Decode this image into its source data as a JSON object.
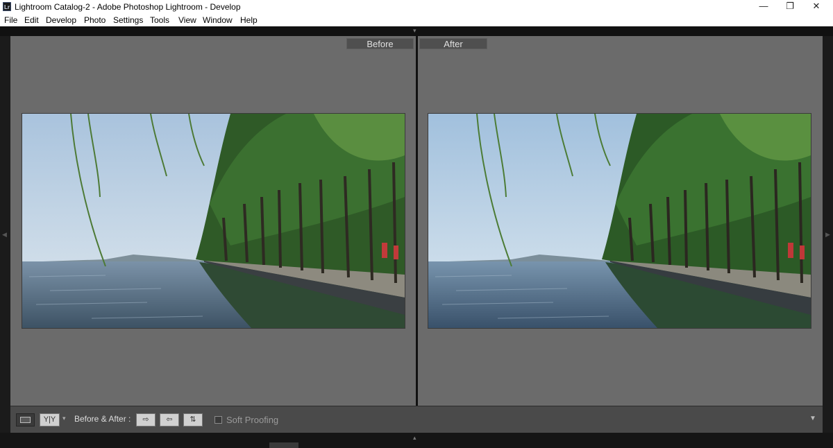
{
  "window": {
    "title": "Lightroom Catalog-2 - Adobe Photoshop Lightroom - Develop",
    "app_icon_label": "Lr",
    "minimize_glyph": "—",
    "restore_glyph": "❐",
    "close_glyph": "✕"
  },
  "menu": {
    "items": [
      "File",
      "Edit",
      "Develop",
      "Photo",
      "Settings",
      "Tools",
      "View",
      "Window",
      "Help"
    ]
  },
  "compare": {
    "before_label": "Before",
    "after_label": "After"
  },
  "toolbar": {
    "view_loupe_icon": "loupe-view-icon",
    "view_yy_label": "Y|Y",
    "dropdown_glyph": "▾",
    "before_after_label": "Before & After :",
    "copy_before_to_after_glyph": "⇨",
    "copy_after_to_before_glyph": "⇦",
    "swap_glyph": "⇅",
    "soft_proofing_label": "Soft Proofing",
    "soft_proofing_checked": false,
    "toolbar_menu_glyph": "▼"
  },
  "colors": {
    "workspace": "#6b6b6b",
    "toolbar": "#4a4a4a",
    "label_bg": "#4f4f4f"
  }
}
